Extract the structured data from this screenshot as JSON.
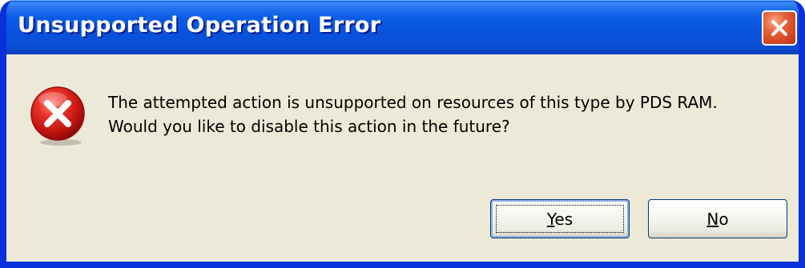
{
  "window": {
    "title": "Unsupported Operation Error"
  },
  "message": {
    "line1": "The attempted action is unsupported on resources of this type by PDS RAM.",
    "line2": "Would you like to disable this action in the future?"
  },
  "icons": {
    "error": "error-icon",
    "close": "close-icon"
  },
  "buttons": {
    "yes": {
      "mnemonic": "Y",
      "rest": "es"
    },
    "no": {
      "mnemonic": "N",
      "rest": "o"
    }
  },
  "colors": {
    "titlebar": "#0a58e6",
    "frame": "#0831d9",
    "body": "#ece9d8",
    "close": "#d2451f",
    "error": "#d91e18"
  }
}
